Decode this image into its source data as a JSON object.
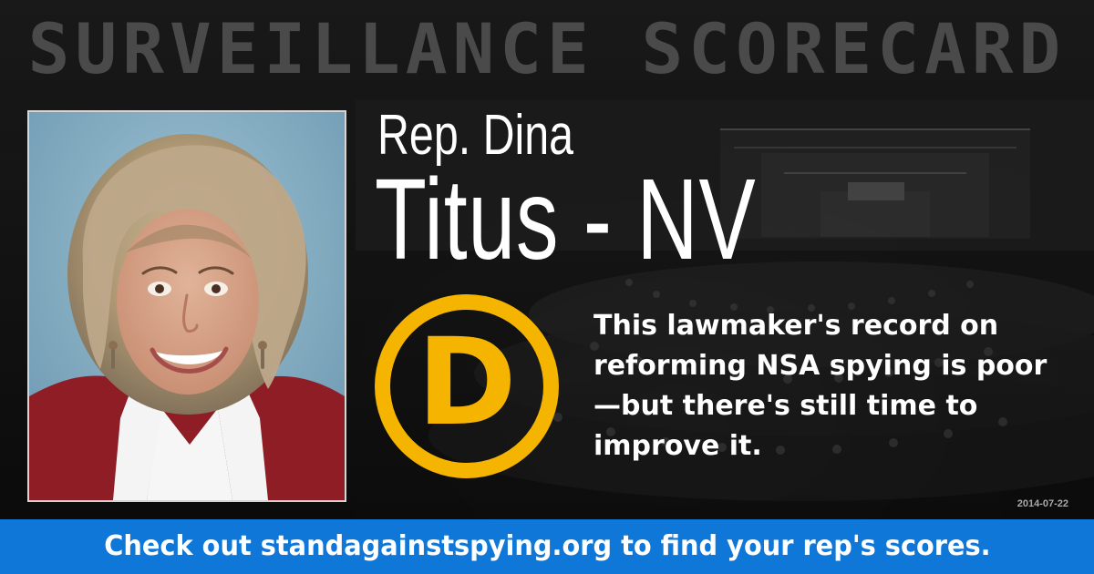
{
  "header": {
    "title": "SURVEILLANCE SCORECARD"
  },
  "representative": {
    "name_line_1": "Rep. Dina",
    "name_line_2": "Titus - NV",
    "grade": "D",
    "summary": "This lawmaker's record on reforming NSA spying is poor—but there's still time to improve it.",
    "date": "2014-07-22"
  },
  "footer": {
    "prefix": "Check out ",
    "link_text": "standagainstspying.org",
    "suffix": " to find your rep's scores."
  },
  "colors": {
    "grade_accent": "#f5b400",
    "footer_background": "#0f77d8",
    "headline_text": "#4a4a4a"
  },
  "icons": {
    "portrait": "portrait-photo"
  }
}
